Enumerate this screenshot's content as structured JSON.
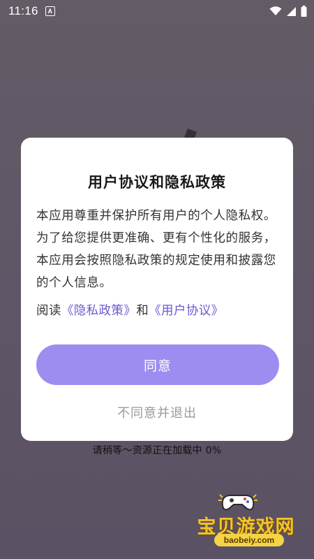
{
  "status_bar": {
    "time": "11:16",
    "notification_icon_letter": "A",
    "icons": [
      "wifi-icon",
      "signal-icon",
      "battery-icon"
    ]
  },
  "dialog": {
    "title": "用户协议和隐私政策",
    "body": "本应用尊重并保护所有用户的个人隐私权。为了给您提供更准确、更有个性化的服务，本应用会按照隐私政策的规定使用和披露您的个人信息。",
    "links_prefix": "阅读",
    "privacy_link": "《隐私政策》",
    "links_conjunction": "和",
    "agreement_link": "《用户协议》",
    "agree_label": "同意",
    "disagree_label": "不同意并退出"
  },
  "loading": {
    "text": "请稍等～资源正在加载中 0%"
  },
  "watermark": {
    "name": "宝贝游戏网",
    "url": "baobeiy.com"
  },
  "colors": {
    "accent": "#9d8df0",
    "link": "#6a5ad1",
    "background": "#605866"
  }
}
